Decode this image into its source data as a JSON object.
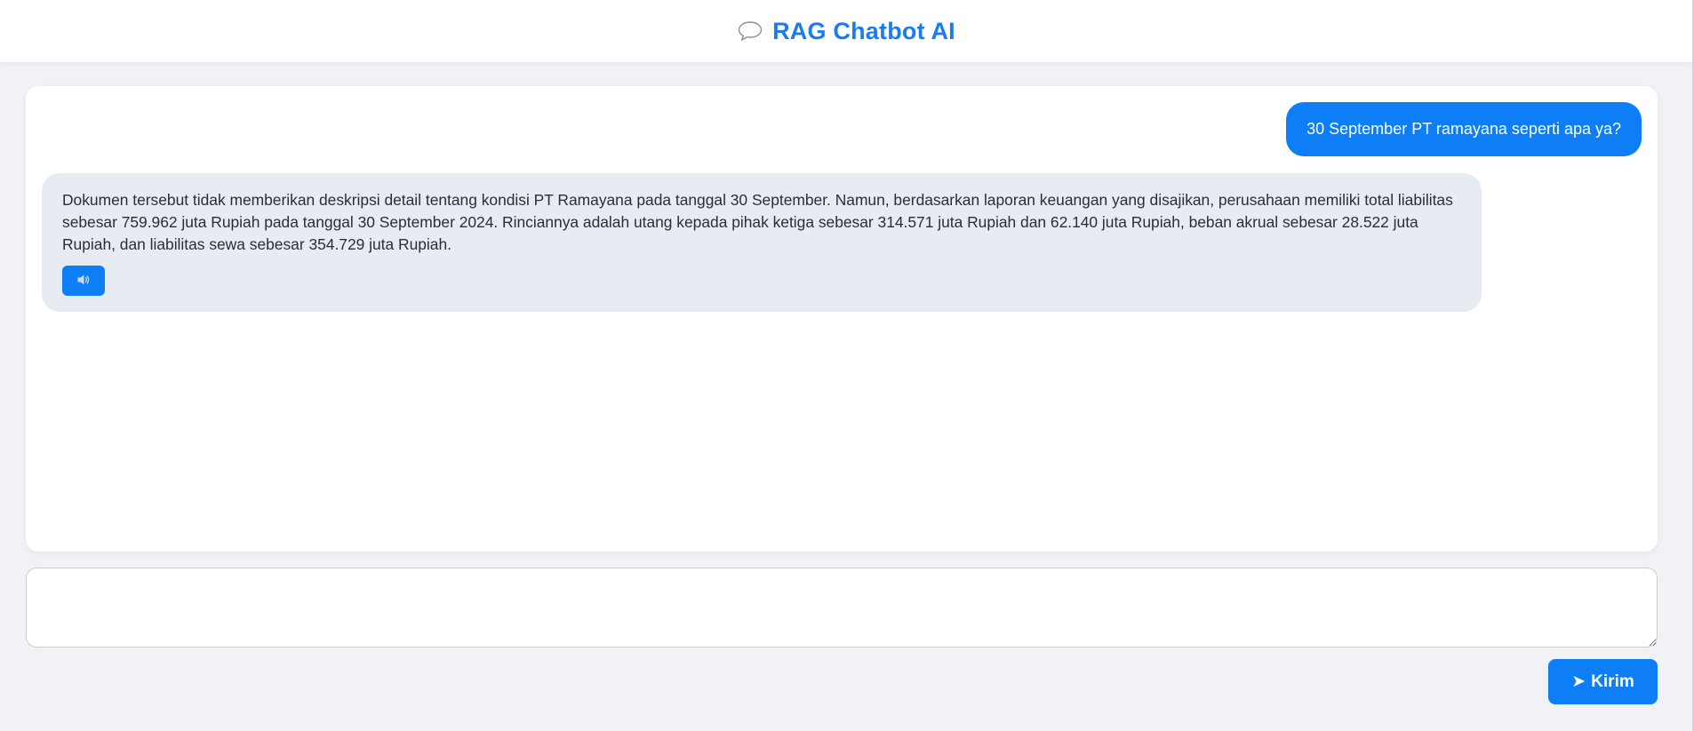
{
  "header": {
    "title": "RAG Chatbot AI",
    "icon": "speech-bubble-icon"
  },
  "chat": {
    "messages": [
      {
        "role": "user",
        "text": "30 September PT ramayana seperti apa ya?"
      },
      {
        "role": "bot",
        "text": "Dokumen tersebut tidak memberikan deskripsi detail tentang kondisi PT Ramayana pada tanggal 30 September. Namun, berdasarkan laporan keuangan yang disajikan, perusahaan memiliki total liabilitas sebesar 759.962 juta Rupiah pada tanggal 30 September 2024. Rinciannya adalah utang kepada pihak ketiga sebesar 314.571 juta Rupiah dan 62.140 juta Rupiah, beban akrual sebesar 28.522 juta Rupiah, dan liabilitas sewa sebesar 354.729 juta Rupiah.",
        "speak_icon": "speaker-icon"
      }
    ]
  },
  "composer": {
    "input_value": "",
    "send_label": "Kirim",
    "send_icon": "send-arrow-icon"
  },
  "colors": {
    "accent": "#0d7ef5",
    "title": "#1a7cf0",
    "page_bg": "#f0f2f5",
    "bot_bubble_bg": "#e7ebf2"
  }
}
